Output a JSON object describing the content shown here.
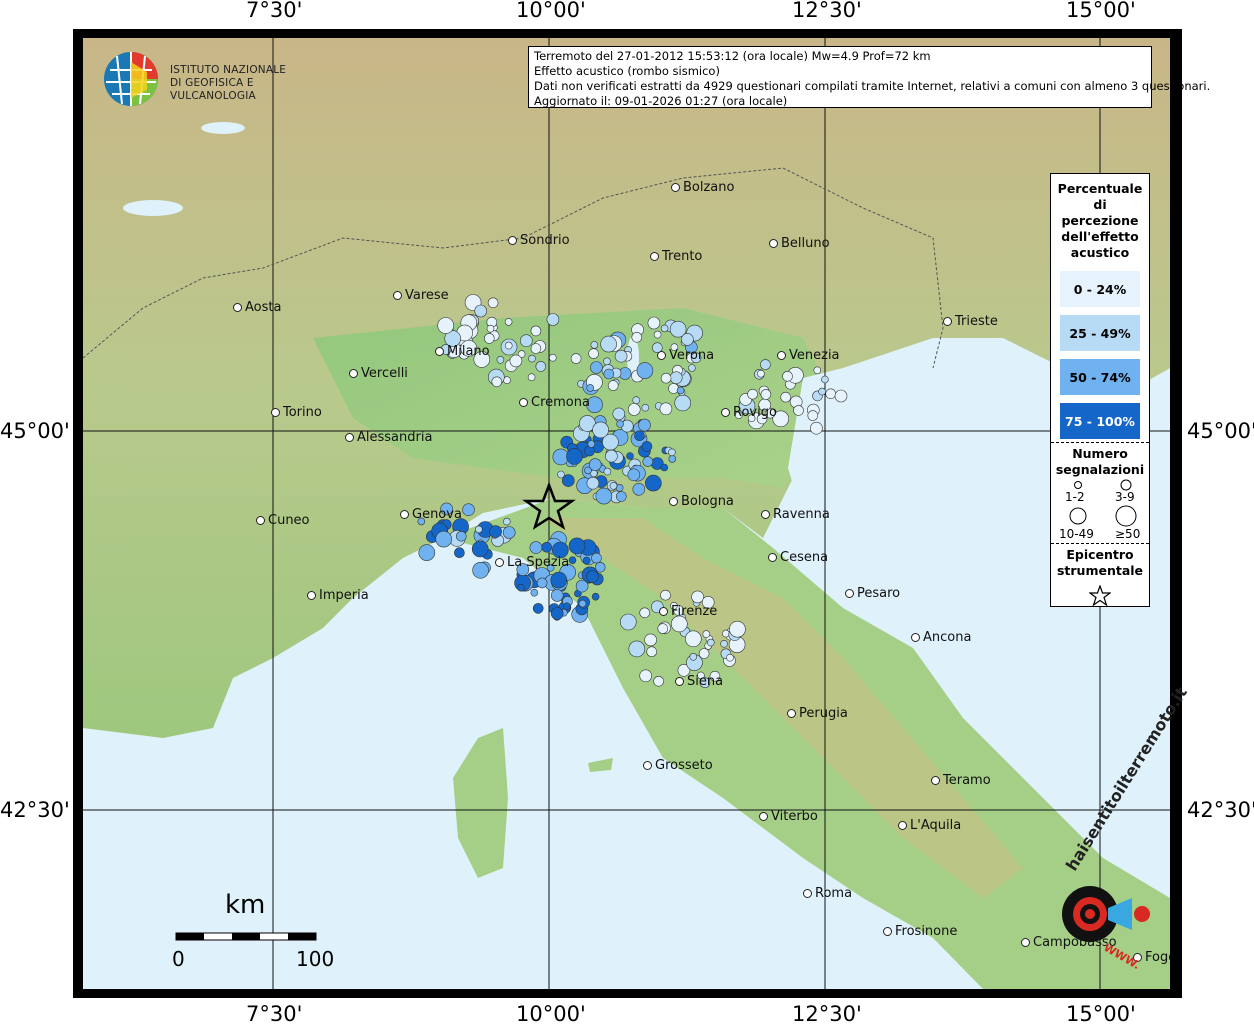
{
  "axes": {
    "top_labels": [
      "7°30'",
      "10°00'",
      "12°30'",
      "15°00'"
    ],
    "bottom_labels": [
      "7°30'",
      "10°00'",
      "12°30'",
      "15°00'"
    ],
    "left_labels": [
      "45°00'",
      "42°30'"
    ],
    "right_labels": [
      "45°00'",
      "42°30'"
    ]
  },
  "logo": {
    "line1": "ISTITUTO NAZIONALE",
    "line2": "DI GEOFISICA E VULCANOLOGIA"
  },
  "info": {
    "line1": "Terremoto del 27-01-2012 15:53:12 (ora locale) Mw=4.9 Prof=72 km",
    "line2": "Effetto acustico (rombo sismico)",
    "line3": "Dati non verificati estratti da 4929 questionari compilati tramite Internet, relativi a comuni con almeno 3 questionari.",
    "line4": "Aggiornato il: 09-01-2026 01:27 (ora locale)"
  },
  "cities": [
    {
      "name": "Bolzano"
    },
    {
      "name": "Sondrio"
    },
    {
      "name": "Trento"
    },
    {
      "name": "Belluno"
    },
    {
      "name": "Aosta"
    },
    {
      "name": "Varese"
    },
    {
      "name": "Milano"
    },
    {
      "name": "Vercelli"
    },
    {
      "name": "Verona"
    },
    {
      "name": "Venezia"
    },
    {
      "name": "Trieste"
    },
    {
      "name": "Cremona"
    },
    {
      "name": "Rovigo"
    },
    {
      "name": "Torino"
    },
    {
      "name": "Alessandria"
    },
    {
      "name": "Bologna"
    },
    {
      "name": "Cuneo"
    },
    {
      "name": "Genova"
    },
    {
      "name": "Ravenna"
    },
    {
      "name": "Cesena"
    },
    {
      "name": "La Spezia"
    },
    {
      "name": "Pesaro"
    },
    {
      "name": "Imperia"
    },
    {
      "name": "Firenze"
    },
    {
      "name": "Ancona"
    },
    {
      "name": "Siena"
    },
    {
      "name": "Perugia"
    },
    {
      "name": "Grosseto"
    },
    {
      "name": "Teramo"
    },
    {
      "name": "Viterbo"
    },
    {
      "name": "L'Aquila"
    },
    {
      "name": "Roma"
    },
    {
      "name": "Frosinone"
    },
    {
      "name": "Campobasso"
    },
    {
      "name": "Foggia"
    }
  ],
  "legend": {
    "title": "Percentuale di percezione dell'effetto acustico",
    "classes": [
      {
        "label": "0 - 24%",
        "color": "#e6f3fc"
      },
      {
        "label": "25 - 49%",
        "color": "#b8dbf5"
      },
      {
        "label": "50 - 74%",
        "color": "#6fb2ef"
      },
      {
        "label": "75 - 100%",
        "color": "#1467c8"
      }
    ],
    "size_title": "Numero segnalazioni",
    "sizes": [
      "1-2",
      "3-9",
      "10-49",
      "≥50"
    ],
    "epicenter_title": "Epicentro strumentale"
  },
  "scale": {
    "unit": "km",
    "start": "0",
    "end": "100"
  },
  "badge": {
    "text": "haisentitoilterremoto.it",
    "url": "WWW."
  }
}
